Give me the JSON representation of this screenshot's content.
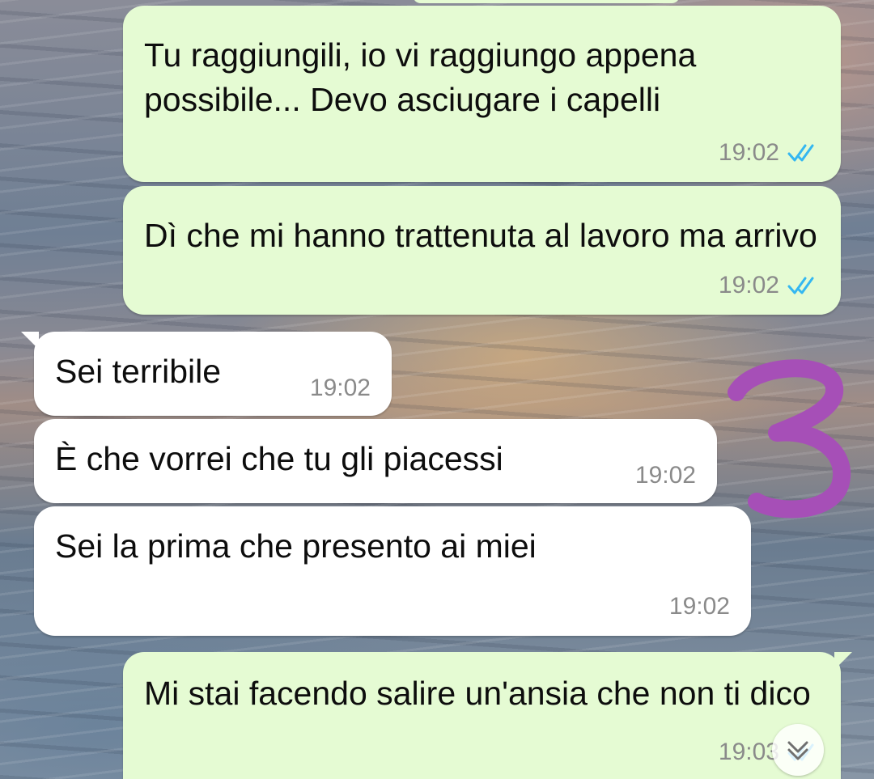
{
  "chat": {
    "messages": [
      {
        "direction": "out",
        "text": "Tu raggiungili, io vi raggiungo appena possibile... Devo asciugare i capelli",
        "time": "19:02",
        "status": "read"
      },
      {
        "direction": "out",
        "text": "Dì che mi hanno trattenuta al lavoro ma arrivo",
        "time": "19:02",
        "status": "read"
      },
      {
        "direction": "in",
        "text": "Sei terribile",
        "time": "19:02"
      },
      {
        "direction": "in",
        "text": "È che vorrei che tu gli piacessi",
        "time": "19:02"
      },
      {
        "direction": "in",
        "text": "Sei la prima che presento ai miei",
        "time": "19:02"
      },
      {
        "direction": "out",
        "text": "Mi stai facendo salire un'ansia che non ti dico",
        "time": "19:03",
        "status": "read"
      }
    ]
  },
  "annotation": {
    "text": "3",
    "color": "#a64fb7"
  },
  "icons": {
    "read_receipt": "double-check-icon",
    "scroll": "chevron-double-down-icon"
  },
  "colors": {
    "outgoing_bubble": "#e5fbd3",
    "incoming_bubble": "#ffffff",
    "tick_blue": "#34b7f1",
    "timestamp": "#8a8a8a"
  }
}
